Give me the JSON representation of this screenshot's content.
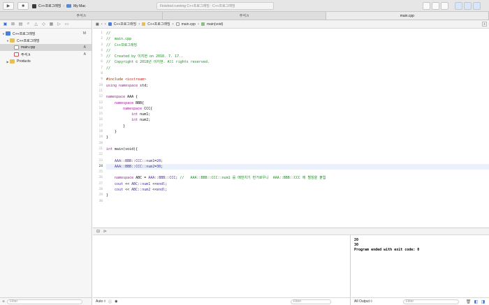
{
  "toolbar": {
    "run_icon": "play-icon",
    "stop_icon": "stop-icon",
    "scheme_name": "C++프로그래밍",
    "destination": "My Mac",
    "status": "Finished running C++프로그래밍 : C++프로그래밍"
  },
  "tabs": [
    {
      "label": "주석.h",
      "active": false
    },
    {
      "label": "주석.h",
      "active": false
    },
    {
      "label": "main.cpp",
      "active": true
    }
  ],
  "navigator": {
    "items": [
      {
        "label": "C++프로그래밍",
        "badge": "M",
        "indent": 0,
        "icon": "project-icon",
        "expanded": true
      },
      {
        "label": "C++프로그래밍",
        "badge": "",
        "indent": 1,
        "icon": "folder-icon",
        "expanded": true
      },
      {
        "label": "main.cpp",
        "badge": "A",
        "indent": 2,
        "icon": "cpp-file-icon",
        "selected": true
      },
      {
        "label": "주석.h",
        "badge": "A",
        "indent": 2,
        "icon": "header-file-icon"
      },
      {
        "label": "Products",
        "badge": "",
        "indent": 0,
        "icon": "folder-icon",
        "expanded": false
      }
    ],
    "filter_placeholder": "Filter"
  },
  "jumpbar": {
    "crumbs": [
      "C++프로그래밍",
      "C++프로그래밍",
      "main.cpp",
      "main(void)"
    ]
  },
  "editor": {
    "current_line": 24,
    "lines": [
      [
        [
          "c",
          "//"
        ]
      ],
      [
        [
          "c",
          "//  main.cpp"
        ]
      ],
      [
        [
          "c",
          "//  C++프로그래밍"
        ]
      ],
      [
        [
          "c",
          "//"
        ]
      ],
      [
        [
          "c",
          "//  Created by 이지현 on 2018. 7. 17.."
        ]
      ],
      [
        [
          "c",
          "//  Copyright © 2018년 이지현. All rights reserved."
        ]
      ],
      [
        [
          "c",
          "//"
        ]
      ],
      [],
      [
        [
          "p",
          "#include "
        ],
        [
          "s",
          "<iostream>"
        ]
      ],
      [
        [
          "k",
          "using namespace "
        ],
        [
          "n",
          "std;"
        ]
      ],
      [],
      [
        [
          "k",
          "namespace "
        ],
        [
          "n",
          "AAA {"
        ]
      ],
      [
        [
          "n",
          "    "
        ],
        [
          "k",
          "namespace "
        ],
        [
          "n",
          "BBB{"
        ]
      ],
      [
        [
          "n",
          "        "
        ],
        [
          "k",
          "namespace "
        ],
        [
          "n",
          "CCC{"
        ]
      ],
      [
        [
          "n",
          "            "
        ],
        [
          "k",
          "int "
        ],
        [
          "n",
          "num1;"
        ]
      ],
      [
        [
          "n",
          "            "
        ],
        [
          "k",
          "int "
        ],
        [
          "n",
          "num2;"
        ]
      ],
      [
        [
          "n",
          "        }"
        ]
      ],
      [
        [
          "n",
          "    }"
        ]
      ],
      [
        [
          "n",
          "}"
        ]
      ],
      [],
      [
        [
          "k",
          "int "
        ],
        [
          "n",
          "main(void){"
        ]
      ],
      [],
      [
        [
          "n",
          "    "
        ],
        [
          "t",
          "AAA::BBB::CCC::num1"
        ],
        [
          "n",
          "="
        ],
        [
          "m",
          "20"
        ],
        [
          "n",
          ";"
        ]
      ],
      [
        [
          "n",
          "    "
        ],
        [
          "t",
          "AAA::BBB::CCC::num2"
        ],
        [
          "n",
          "="
        ],
        [
          "m",
          "30"
        ],
        [
          "n",
          ";"
        ]
      ],
      [],
      [
        [
          "n",
          "    "
        ],
        [
          "k",
          "namespace "
        ],
        [
          "n",
          "ABC = "
        ],
        [
          "t",
          "AAA::BBB::CCC"
        ],
        [
          "n",
          "; "
        ],
        [
          "c",
          "//   AAA::BBB::CCC::num1 를 매번치기 번거로우니  AAA::BBB::CCC 에 별칭을 붙힘"
        ]
      ],
      [
        [
          "n",
          "    "
        ],
        [
          "t",
          "cout"
        ],
        [
          "n",
          " << "
        ],
        [
          "t",
          "ABC::num1"
        ],
        [
          "n",
          " <<"
        ],
        [
          "t",
          "endl"
        ],
        [
          "n",
          ";"
        ]
      ],
      [
        [
          "n",
          "    "
        ],
        [
          "t",
          "cout"
        ],
        [
          "n",
          " << "
        ],
        [
          "t",
          "ABC::num2"
        ],
        [
          "n",
          " <<"
        ],
        [
          "t",
          "endl"
        ],
        [
          "n",
          ";"
        ]
      ],
      [
        [
          "n",
          "}"
        ]
      ],
      []
    ]
  },
  "variables": {
    "scope": "Auto ◊",
    "filter_placeholder": "Filter"
  },
  "console": {
    "output": "20\n30\nProgram ended with exit code: 0",
    "mode": "All Output ◊",
    "filter_placeholder": "Filter"
  }
}
